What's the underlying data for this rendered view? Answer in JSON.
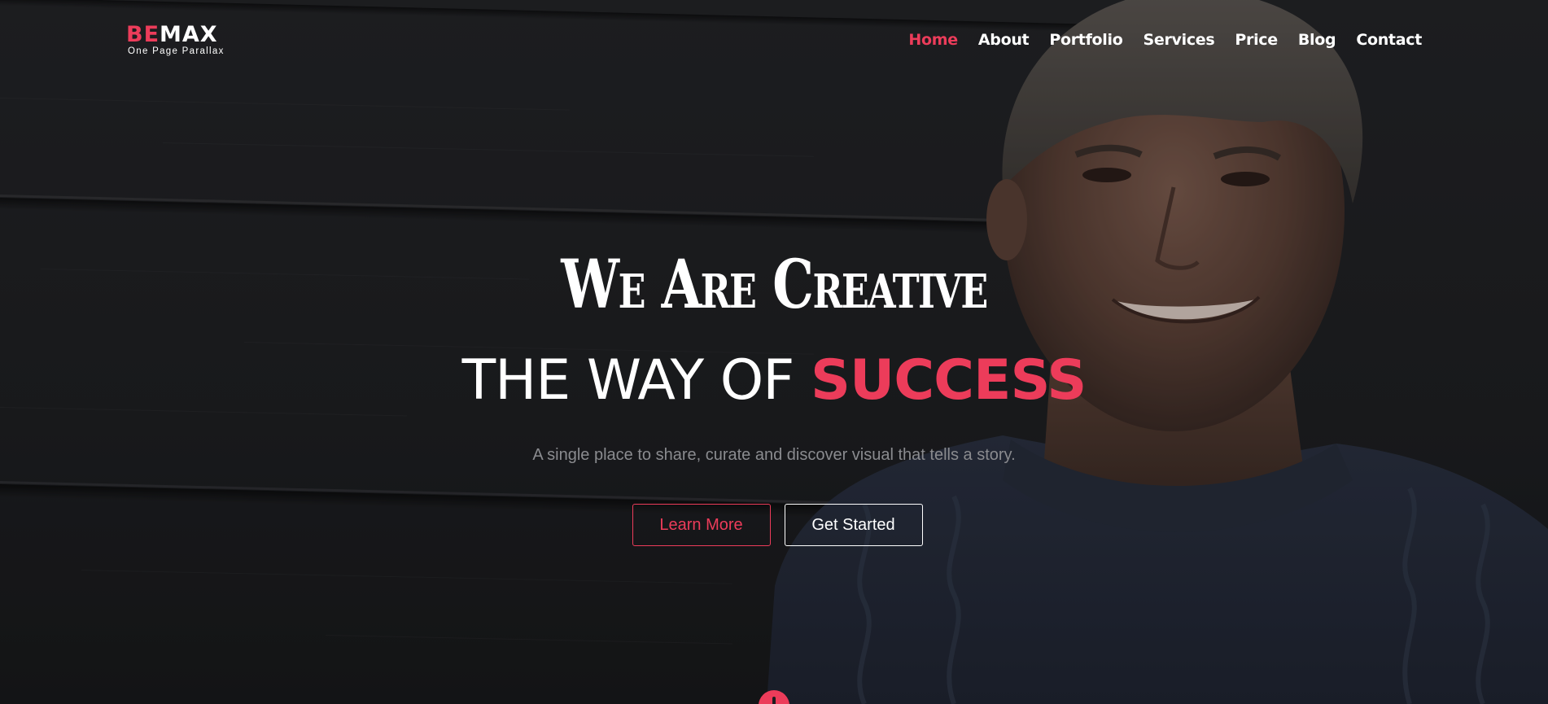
{
  "logo": {
    "accent": "BE",
    "main": "MAX",
    "tagline": "One Page Parallax"
  },
  "nav": {
    "items": [
      {
        "label": "Home",
        "active": true
      },
      {
        "label": "About",
        "active": false
      },
      {
        "label": "Portfolio",
        "active": false
      },
      {
        "label": "Services",
        "active": false
      },
      {
        "label": "Price",
        "active": false
      },
      {
        "label": "Blog",
        "active": false
      },
      {
        "label": "Contact",
        "active": false
      }
    ]
  },
  "hero": {
    "script_title": "We Are Creative",
    "headline_prefix": "THE WAY OF ",
    "headline_accent": "SUCCESS",
    "subtitle": "A single place to share, curate and discover visual that tells a story.",
    "learn_more_label": "Learn More",
    "get_started_label": "Get Started"
  },
  "icons": {
    "scroll": "scroll-down-icon"
  },
  "colors": {
    "accent": "#ec3c5a",
    "text": "#ffffff",
    "muted": "#8a8b8f",
    "background": "#1c1d20"
  }
}
